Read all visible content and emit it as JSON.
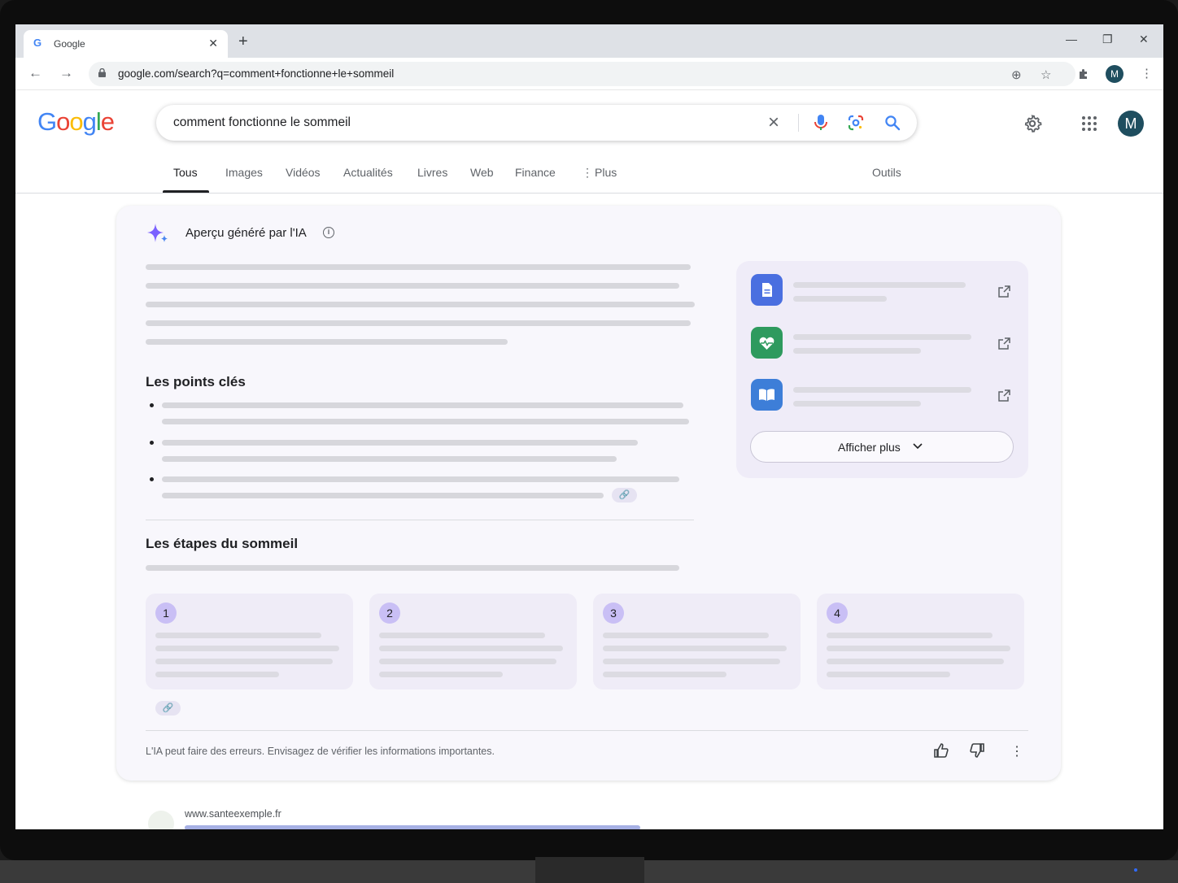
{
  "browser": {
    "tab_title": "Google",
    "tab_favicon": "G",
    "url": "google.com/search?q=comment+fonctionne+le+sommeil",
    "profile_initial": "M"
  },
  "search": {
    "query": "comment fonctionne le sommeil",
    "profile_initial": "M"
  },
  "tabs": {
    "tous": "Tous",
    "images": "Images",
    "videos": "Vidéos",
    "actualites": "Actualités",
    "livres": "Livres",
    "web": "Web",
    "finance": "Finance",
    "plus": "Plus",
    "outils": "Outils"
  },
  "ai_overview": {
    "title": "Aperçu généré par l'IA",
    "key_points_heading": "Les points clés",
    "stages_heading": "Les étapes du sommeil",
    "show_more": "Afficher plus",
    "steps": [
      "1",
      "2",
      "3",
      "4"
    ],
    "disclaimer": "L'IA peut faire des erreurs. Envisagez de vérifier les informations importantes.",
    "colors": {
      "accent_purple": "#7b61ff",
      "source_doc": "#4a6fe0",
      "source_health": "#2e9a5e",
      "source_book": "#3d7ed8"
    }
  },
  "result": {
    "site": "www.santeexemple.fr"
  }
}
